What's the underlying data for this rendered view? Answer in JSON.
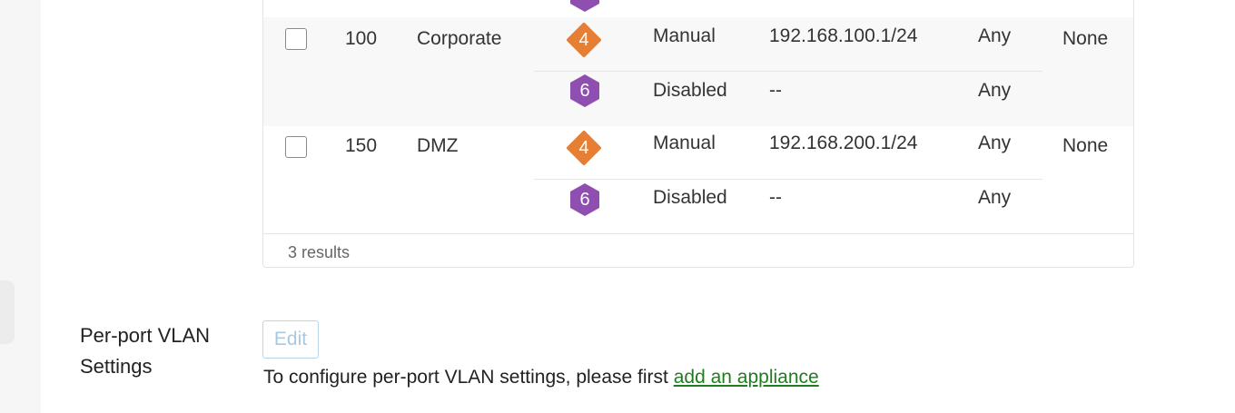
{
  "table": {
    "rows": [
      {
        "id": "100",
        "name": "Corporate",
        "ipv4": {
          "badge": "4",
          "mode": "Manual",
          "subnet": "192.168.100.1/24",
          "scope": "Any"
        },
        "ipv6": {
          "badge": "6",
          "mode": "Disabled",
          "subnet": "--",
          "scope": "Any"
        },
        "policy": "None"
      },
      {
        "id": "150",
        "name": "DMZ",
        "ipv4": {
          "badge": "4",
          "mode": "Manual",
          "subnet": "192.168.200.1/24",
          "scope": "Any"
        },
        "ipv6": {
          "badge": "6",
          "mode": "Disabled",
          "subnet": "--",
          "scope": "Any"
        },
        "policy": "None"
      }
    ],
    "results_text": "3 results"
  },
  "per_port": {
    "label": "Per-port VLAN Settings",
    "edit_label": "Edit",
    "config_text": "To configure per-port VLAN settings, please first ",
    "config_link": "add an appliance"
  },
  "colors": {
    "ipv4_badge": "#e67e33",
    "ipv6_badge": "#8e4fb0",
    "link": "#1e7e1e"
  }
}
